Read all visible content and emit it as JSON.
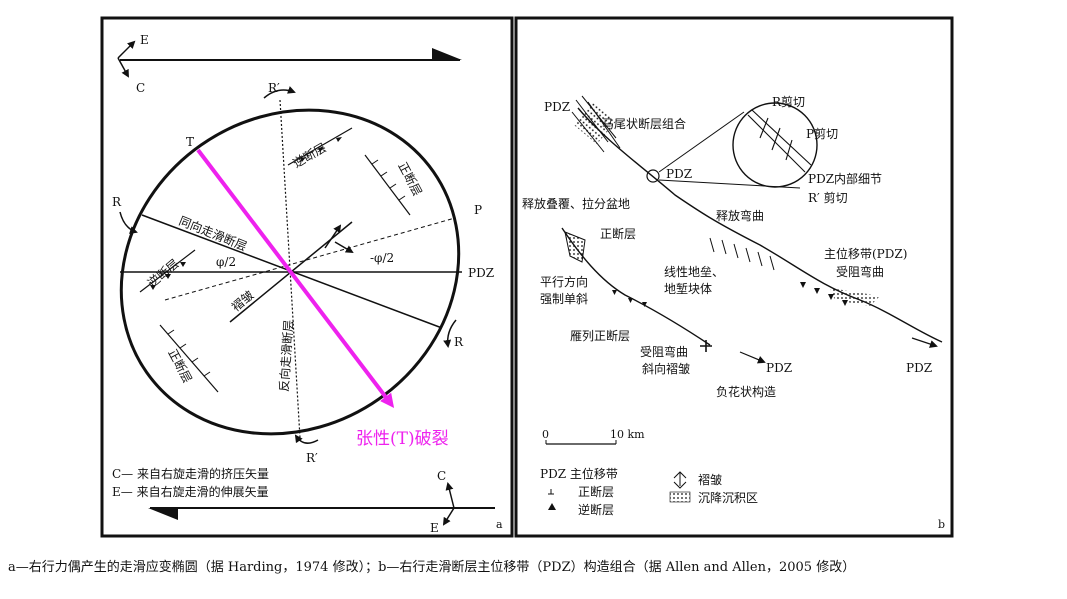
{
  "panel_a": {
    "compass_top": {
      "e": "E",
      "c": "C"
    },
    "compass_bottom": {
      "c": "C",
      "e": "E"
    },
    "labels": {
      "r_prime_top": "R′",
      "t": "T",
      "r_left": "R",
      "p": "P",
      "pdz": "PDZ",
      "r_right": "R",
      "r_prime_bottom": "R′",
      "reverse_fault_top": "逆断层",
      "normal_fault_top": "正断层",
      "sync_strike_slip": "同向走滑断层",
      "reverse_fault_left": "逆断层",
      "phi_half_left": "φ/2",
      "phi_half_right": "-φ/2",
      "fold": "褶皱",
      "antithetic_strike_slip": "反向走滑断层",
      "normal_fault_bottom": "正断层",
      "tension_fracture": "张性(T)破裂"
    },
    "legend": {
      "c": "C— 来自右旋走滑的挤压矢量",
      "e": "E— 来自右旋走滑的伸展矢量"
    },
    "panel_letter": "a",
    "highlight_color": "#ee22ee"
  },
  "panel_b": {
    "labels": {
      "pdz_top": "PDZ",
      "horsetail": "马尾状断层组合",
      "r_shear": "R剪切",
      "p_shear": "P剪切",
      "pdz_mid": "PDZ",
      "pdz_detail": "PDZ内部细节",
      "r_prime_shear": "R′ 剪切",
      "release_overlap": "释放叠覆、拉分盆地",
      "release_bend": "释放弯曲",
      "normal_fault": "正断层",
      "main_pdz": "主位移带(PDZ)",
      "restraining_bend_right": "受阻弯曲",
      "parallel_1": "平行方向",
      "parallel_2": "强制单斜",
      "horst_1": "线性地垒、",
      "horst_2": "地堑块体",
      "echelon": "雁列正断层",
      "restraining_bend_low": "受阻弯曲",
      "oblique_fold": "斜向褶皱",
      "pdz_bottom_a": "PDZ",
      "pdz_bottom_b": "PDZ",
      "flower": "负花状构造"
    },
    "scale": {
      "zero": "0",
      "ten": "10 km"
    },
    "legend": {
      "pdz": "PDZ 主位移带",
      "normal": "正断层",
      "reverse": "逆断层",
      "fold": "褶皱",
      "basin": "沉降沉积区"
    },
    "panel_letter": "b"
  },
  "caption": "a—右行力偶产生的走滑应变椭圆（据 Harding，1974 修改）；b—右行走滑断层主位移带（PDZ）构造组合（据 Allen and Allen，2005 修改）"
}
